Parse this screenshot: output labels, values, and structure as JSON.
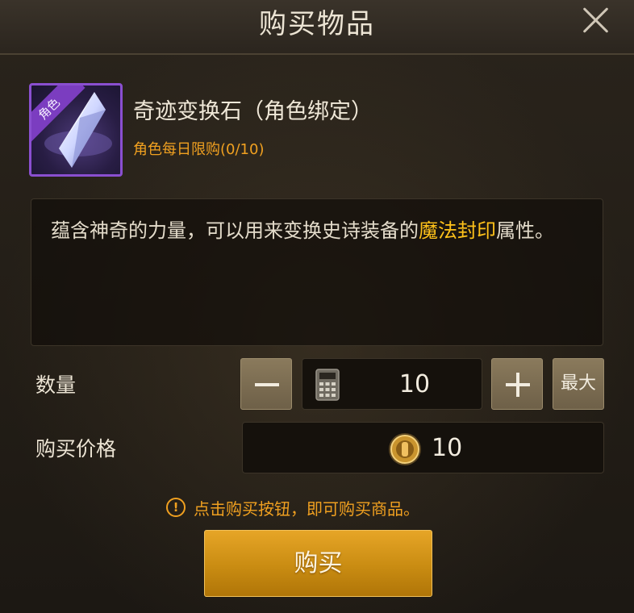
{
  "dialog": {
    "title": "购买物品",
    "close_icon": "close-icon"
  },
  "item": {
    "name": "奇迹变换石（角色绑定）",
    "limit": "角色每日限购(0/10)",
    "badge": "角色",
    "icon": "crystal-gem-icon",
    "rarity_color": "#8a4fd0"
  },
  "description": {
    "text_before": "蕴含神奇的力量，可以用来变换史诗装备的",
    "highlight": "魔法封印",
    "text_after": "属性。",
    "highlight_color": "#ffc21a"
  },
  "quantity": {
    "label": "数量",
    "value": "10",
    "max_label": "最大",
    "minus_icon": "minus-icon",
    "plus_icon": "plus-icon",
    "calculator_icon": "calculator-icon"
  },
  "price": {
    "label": "购买价格",
    "value": "10",
    "currency_icon": "coin-icon"
  },
  "notice": {
    "text": "点击购买按钮，即可购买商品。",
    "icon": "warning-icon"
  },
  "buy_button": {
    "label": "购买"
  },
  "colors": {
    "accent": "#f0a020",
    "button": "#c98c12"
  }
}
